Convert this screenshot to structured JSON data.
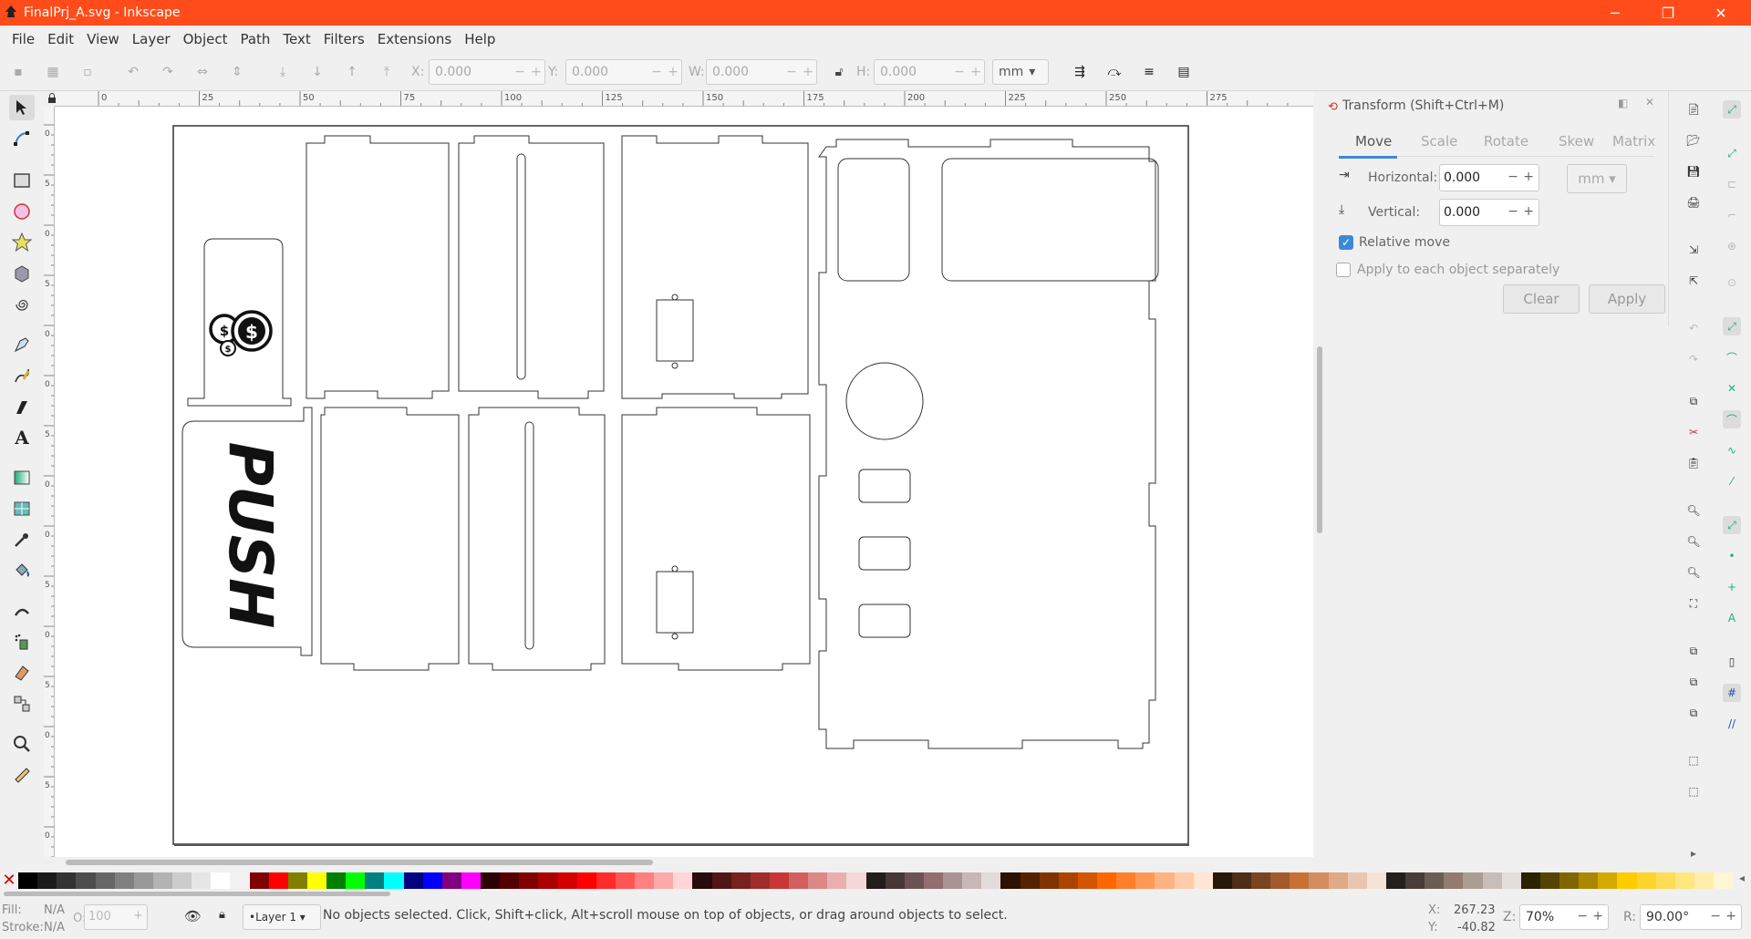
{
  "window": {
    "title": "FinalPrj_A.svg - Inkscape"
  },
  "menu": [
    "File",
    "Edit",
    "View",
    "Layer",
    "Object",
    "Path",
    "Text",
    "Filters",
    "Extensions",
    "Help"
  ],
  "controls": {
    "x_label": "X:",
    "x_value": "0.000",
    "y_label": "Y:",
    "y_value": "0.000",
    "w_label": "W:",
    "w_value": "0.000",
    "h_label": "H:",
    "h_value": "0.000",
    "unit": "mm"
  },
  "ruler_top": [
    "0",
    "25",
    "50",
    "75",
    "100",
    "125",
    "150",
    "175",
    "200",
    "225",
    "250",
    "275"
  ],
  "ruler_left": [
    "0",
    "5",
    "0",
    "5",
    "0",
    "0",
    "5",
    "0",
    "0",
    "5",
    "0",
    "5",
    "0",
    "5",
    "0"
  ],
  "canvas": {
    "push_text": "PUSH",
    "coin_symbol": "$"
  },
  "transform": {
    "title": "Transform (Shift+Ctrl+M)",
    "tabs": [
      "Move",
      "Scale",
      "Rotate",
      "Skew",
      "Matrix"
    ],
    "active_tab": "Move",
    "horizontal_label": "Horizontal:",
    "horizontal_value": "0.000",
    "vertical_label": "Vertical:",
    "vertical_value": "0.000",
    "unit": "mm",
    "relative_move_label": "Relative move",
    "relative_move_checked": true,
    "apply_each_label": "Apply to each object separately",
    "apply_each_checked": false,
    "clear_label": "Clear",
    "apply_label": "Apply"
  },
  "status": {
    "fill_label": "Fill:",
    "fill_value": "N/A",
    "stroke_label": "Stroke:",
    "stroke_value": "N/A",
    "opacity_label": "O:",
    "opacity_value": "100",
    "layer": "•Layer 1",
    "message": "No objects selected. Click, Shift+click, Alt+scroll mouse on top of objects, or drag around objects to select.",
    "cursor_x_label": "X:",
    "cursor_x": "267.23",
    "cursor_y_label": "Y:",
    "cursor_y": "-40.82",
    "zoom_label": "Z:",
    "zoom": "70%",
    "rotate_label": "R:",
    "rotate": "90.00°"
  },
  "palette": [
    "#000000",
    "#1a1a1a",
    "#333333",
    "#4d4d4d",
    "#666666",
    "#808080",
    "#999999",
    "#b3b3b3",
    "#cccccc",
    "#e6e6e6",
    "#ffffff",
    "#f2f2f2",
    "#800000",
    "#ff0000",
    "#808000",
    "#ffff00",
    "#008000",
    "#00ff00",
    "#008080",
    "#00ffff",
    "#000080",
    "#0000ff",
    "#800080",
    "#ff00ff",
    "#2b0000",
    "#550000",
    "#800000",
    "#aa0000",
    "#d40000",
    "#ff0000",
    "#ff2a2a",
    "#ff5555",
    "#ff8080",
    "#ffaaaa",
    "#ffd5d5",
    "#280b0b",
    "#501616",
    "#782121",
    "#a02c2c",
    "#c83737",
    "#d35f5f",
    "#de8787",
    "#e9afaf",
    "#f4d7d7",
    "#241c1c",
    "#483737",
    "#6c5353",
    "#916f6f",
    "#ac9393",
    "#c8b7b7",
    "#e3dbdb",
    "#2b1100",
    "#552200",
    "#803300",
    "#aa4400",
    "#d45500",
    "#ff6600",
    "#ff7f2a",
    "#ff9955",
    "#ffb380",
    "#ffccaa",
    "#ffe6d5",
    "#28170b",
    "#502d16",
    "#784421",
    "#a05a2c",
    "#c87137",
    "#d38d5f",
    "#deaa87",
    "#e9c6af",
    "#f4e3d7",
    "#241f1c",
    "#483e37",
    "#6c5d53",
    "#917c6f",
    "#ac9d93",
    "#c8beb7",
    "#e3dedb",
    "#2b2200",
    "#554400",
    "#806600",
    "#aa8800",
    "#d4aa00",
    "#ffcc00",
    "#ffd42a",
    "#ffdd55",
    "#ffe680",
    "#ffeeaa",
    "#fff6d5"
  ]
}
